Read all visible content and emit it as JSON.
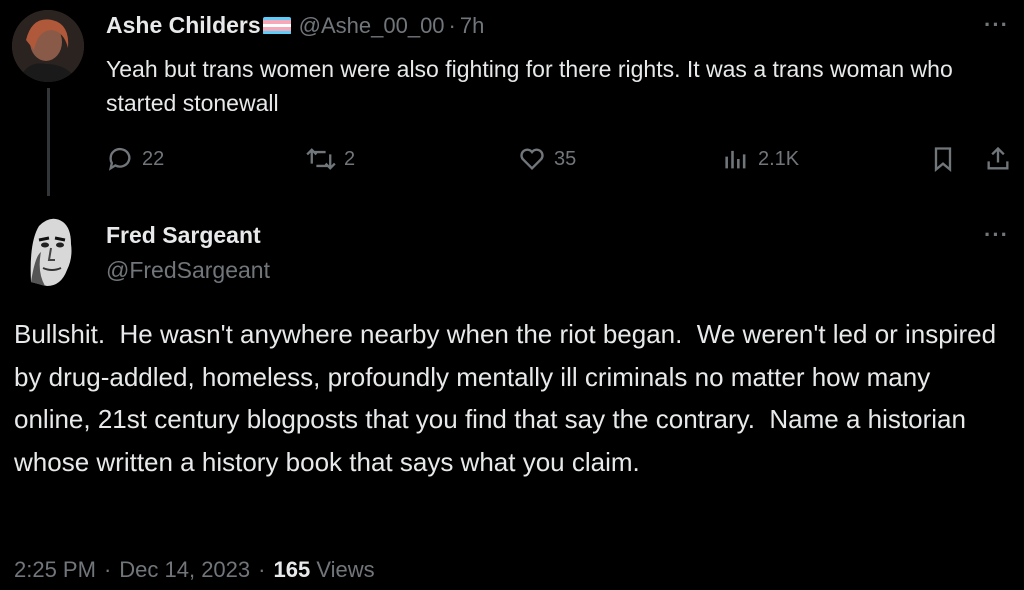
{
  "reply": {
    "display_name": "Ashe Childers",
    "flag_colors": [
      "#5bcefa",
      "#f5a9b8",
      "#ffffff",
      "#f5a9b8",
      "#5bcefa"
    ],
    "handle": "@Ashe_00_00",
    "separator": "·",
    "time": "7h",
    "text": "Yeah but trans women were also fighting for there rights. It was a trans woman who started stonewall",
    "more": "···",
    "replies": "22",
    "reposts": "2",
    "likes": "35",
    "views": "2.1K",
    "icons": [
      "reply-icon",
      "repost-icon",
      "like-icon",
      "views-icon",
      "bookmark-icon",
      "share-icon"
    ]
  },
  "main": {
    "display_name": "Fred Sargeant",
    "handle": "@FredSargeant",
    "more": "···",
    "text": "Bullshit.  He wasn't anywhere nearby when the riot began.  We weren't led or inspired by drug-addled, homeless, profoundly mentally ill criminals no matter how many online, 21st century blogposts that you find that say the contrary.  Name a historian whose written a history book that says what you claim.",
    "time": "2:25 PM",
    "separator": "·",
    "date": "Dec 14, 2023",
    "views_count": "165",
    "views_label": "Views"
  },
  "colors": {
    "background": "#000000",
    "text": "#e7e9ea",
    "muted": "#71767b"
  }
}
